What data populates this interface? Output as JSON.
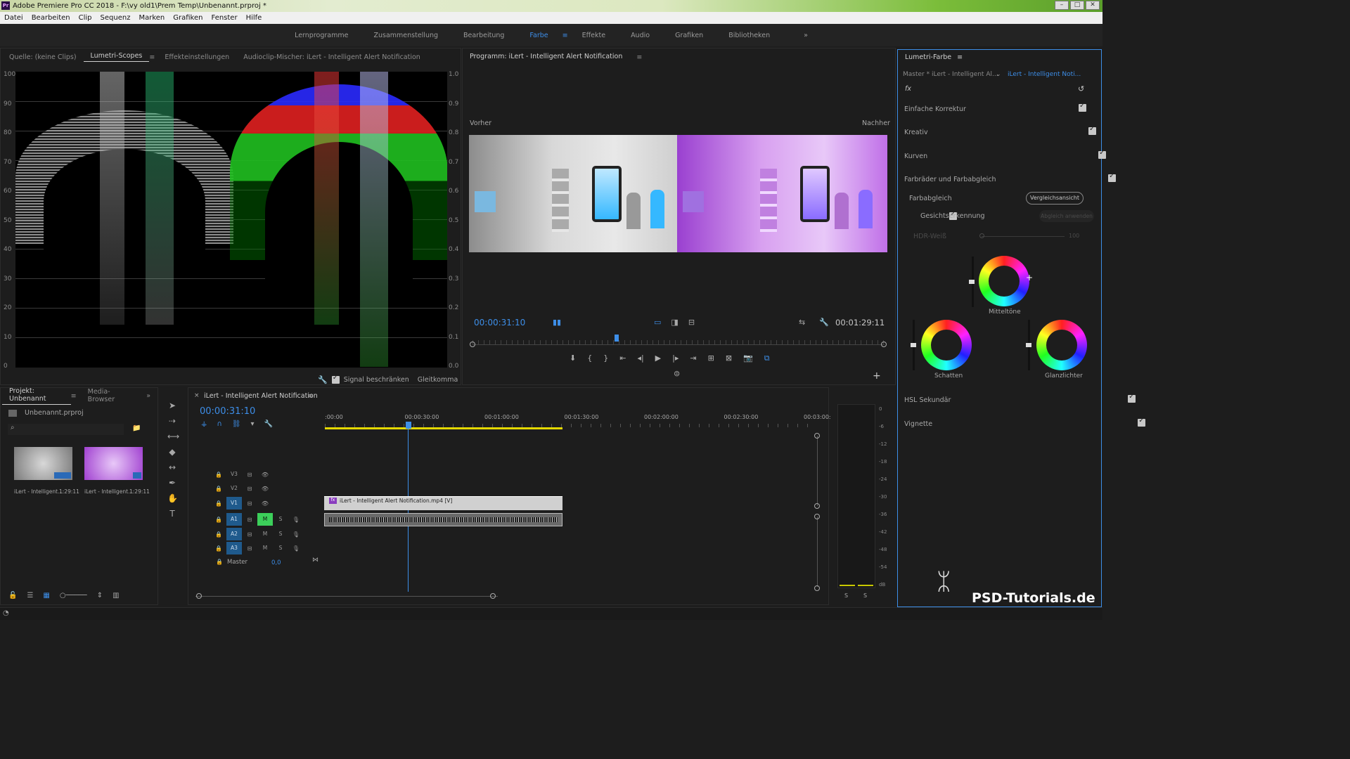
{
  "window": {
    "title": "Adobe Premiere Pro CC 2018 - F:\\vy old1\\Prem Temp\\Unbenannt.prproj *",
    "app_badge": "Pr"
  },
  "menu": [
    "Datei",
    "Bearbeiten",
    "Clip",
    "Sequenz",
    "Marken",
    "Grafiken",
    "Fenster",
    "Hilfe"
  ],
  "workspaces": [
    "Lernprogramme",
    "Zusammenstellung",
    "Bearbeitung",
    "Farbe",
    "Effekte",
    "Audio",
    "Grafiken",
    "Bibliotheken"
  ],
  "workspace_active": "Farbe",
  "source_tabs": [
    "Quelle: (keine Clips)",
    "Lumetri-Scopes",
    "Effekteinstellungen",
    "Audioclip-Mischer: iLert - Intelligent Alert Notification"
  ],
  "scopes": {
    "left_ticks": [
      "100",
      "90",
      "80",
      "70",
      "60",
      "50",
      "40",
      "30",
      "20",
      "10",
      "0"
    ],
    "right_ticks": [
      "1.0",
      "0.9",
      "0.8",
      "0.7",
      "0.6",
      "0.5",
      "0.4",
      "0.3",
      "0.2",
      "0.1",
      "0.0"
    ],
    "signal_clamp_label": "Signal beschränken",
    "mode": "Gleitkomma"
  },
  "program": {
    "title": "Programm: iLert - Intelligent Alert Notification",
    "before_label": "Vorher",
    "after_label": "Nachher",
    "timecode": "00:00:31:10",
    "duration": "00:01:29:11",
    "playhead_fraction": 0.35
  },
  "lumetri": {
    "title": "Lumetri-Farbe",
    "master": "Master * iLert - Intelligent Al...",
    "clip": "iLert - Intelligent Noti...",
    "fx": "fx",
    "sections": [
      "Einfache Korrektur",
      "Kreativ",
      "Kurven",
      "Farbräder und Farbabgleich"
    ],
    "farbabgleich": "Farbabgleich",
    "vergleich_button": "Vergleichsansicht",
    "face_detect": "Gesichtserkennung",
    "match_button": "Abgleich anwenden",
    "hdr_label": "HDR-Weiß",
    "hdr_value": "100",
    "wheel_mid": "Mitteltöne",
    "wheel_shadows": "Schatten",
    "wheel_highlights": "Glanzlichter",
    "hsl": "HSL Sekundär",
    "vignette": "Vignette"
  },
  "project": {
    "tabs": [
      "Projekt: Unbenannt",
      "Media-Browser"
    ],
    "file": "Unbenannt.prproj",
    "items": [
      {
        "name": "iLert - Intelligent...",
        "duration": "1:29:11"
      },
      {
        "name": "iLert - Intelligent...",
        "duration": "1:29:11"
      }
    ]
  },
  "timeline": {
    "title": "iLert - Intelligent Alert Notification",
    "timecode": "00:00:31:10",
    "ruler": [
      ":00:00",
      "00:00:30:00",
      "00:01:00:00",
      "00:01:30:00",
      "00:02:00:00",
      "00:02:30:00",
      "00:03:00:"
    ],
    "video_tracks": [
      "V3",
      "V2",
      "V1"
    ],
    "audio_tracks": [
      "A1",
      "A2",
      "A3"
    ],
    "master_label": "Master",
    "master_value": "0,0",
    "clip_video": "iLert - Intelligent Alert Notification.mp4 [V]",
    "mute": "M",
    "solo": "S"
  },
  "meter": {
    "ticks": [
      "0",
      "-6",
      "-12",
      "-18",
      "-24",
      "-30",
      "-36",
      "-42",
      "-48",
      "-54",
      "dB"
    ],
    "solo": [
      "S",
      "S"
    ]
  },
  "watermark": "PSD-Tutorials.de"
}
